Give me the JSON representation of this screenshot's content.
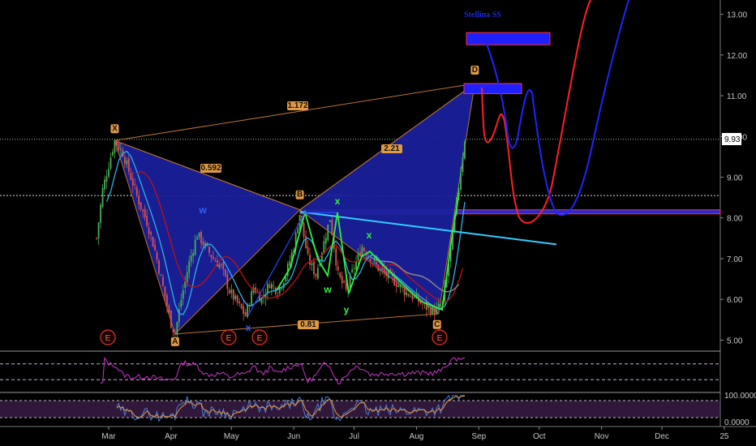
{
  "colors": {
    "background": "#000000",
    "pattern_fill": "#1a1f9e",
    "pattern_edge": "#b87333",
    "candle_up": "#4caf50",
    "candle_down": "#d9534f",
    "price_tag": "#ffffff",
    "trend_line": "#33ccff",
    "projection_red": "#ff2020",
    "projection_blue": "#2222ff",
    "rsi": "#cc33cc",
    "stoch_fast": "#4a7fd9",
    "stoch_slow": "#e39b3c",
    "zone_box": "#2020ff",
    "zone_border": "#ff3030"
  },
  "annotation_text": "Stellina SS",
  "price_tag": "9.93",
  "chart_data": {
    "type": "candlestick",
    "title": "",
    "xlabel": "",
    "ylabel": "",
    "x_ticks": [
      "Mar",
      "Apr",
      "May",
      "Jun",
      "Jul",
      "Aug",
      "Sep",
      "Oct",
      "Nov",
      "Dec",
      "25"
    ],
    "y_ticks": [
      "13.00",
      "12.00",
      "11.00",
      "10.00",
      "9.00",
      "8.00",
      "7.00",
      "6.00",
      "5.00"
    ],
    "ylim": [
      4.75,
      13.35
    ],
    "xlim_days": [
      0,
      310
    ],
    "tick_days": [
      0,
      31,
      61,
      92,
      122,
      153,
      184,
      214,
      245,
      275,
      306
    ],
    "price_path": [
      [
        "Feb 24",
        7.5
      ],
      [
        "Feb 27",
        8.7
      ],
      [
        "Mar 1",
        9.3
      ],
      [
        "Mar 4",
        9.9
      ],
      [
        "Mar 8",
        9.6
      ],
      [
        "Mar 12",
        9.0
      ],
      [
        "Mar 16",
        8.4
      ],
      [
        "Mar 20",
        7.9
      ],
      [
        "Mar 24",
        7.2
      ],
      [
        "Mar 28",
        6.3
      ],
      [
        "Apr 1",
        5.4
      ],
      [
        "Apr 3",
        5.15
      ],
      [
        "Apr 6",
        6.0
      ],
      [
        "Apr 10",
        6.9
      ],
      [
        "Apr 14",
        7.6
      ],
      [
        "Apr 18",
        7.3
      ],
      [
        "Apr 22",
        7.0
      ],
      [
        "Apr 26",
        6.8
      ],
      [
        "Apr 30",
        6.2
      ],
      [
        "May 4",
        5.9
      ],
      [
        "May 8",
        5.6
      ],
      [
        "May 12",
        6.3
      ],
      [
        "May 16",
        6.0
      ],
      [
        "May 20",
        6.4
      ],
      [
        "May 24",
        6.2
      ],
      [
        "May 28",
        6.6
      ],
      [
        "Jun 1",
        7.3
      ],
      [
        "Jun 4",
        8.1
      ],
      [
        "Jun 8",
        7.0
      ],
      [
        "Jun 12",
        6.6
      ],
      [
        "Jun 16",
        7.4
      ],
      [
        "Jun 19",
        8.0
      ],
      [
        "Jun 23",
        6.6
      ],
      [
        "Jun 27",
        6.2
      ],
      [
        "Jul 1",
        6.8
      ],
      [
        "Jul 5",
        7.3
      ],
      [
        "Jul 9",
        7.0
      ],
      [
        "Jul 14",
        6.7
      ],
      [
        "Jul 20",
        6.5
      ],
      [
        "Jul 26",
        6.2
      ],
      [
        "Aug 1",
        6.0
      ],
      [
        "Aug 6",
        5.8
      ],
      [
        "Aug 10",
        5.7
      ],
      [
        "Aug 14",
        5.9
      ],
      [
        "Aug 18",
        7.2
      ],
      [
        "Aug 20",
        8.0
      ],
      [
        "Aug 22",
        8.8
      ],
      [
        "Aug 25",
        9.93
      ]
    ],
    "pattern_points": [
      {
        "label": "X",
        "date": "Mar 4",
        "price": 9.9
      },
      {
        "label": "A",
        "date": "Apr 3",
        "price": 5.15
      },
      {
        "label": "B",
        "date": "Jun 4",
        "price": 8.2
      },
      {
        "label": "C",
        "date": "Aug 12",
        "price": 5.65
      },
      {
        "label": "D",
        "date": "Aug 30",
        "price": 11.3
      }
    ],
    "ratios": [
      "0.592",
      "1.172",
      "2.21",
      "0.81"
    ],
    "wave_labels": [
      "w",
      "w",
      "x",
      "x",
      "y",
      "x"
    ],
    "event_markers": [
      "E",
      "E",
      "E",
      "E"
    ],
    "hlines": [
      9.93,
      8.55,
      8.2,
      8.1
    ],
    "zones": [
      {
        "y_top": 12.55,
        "y_bottom": 12.25
      },
      {
        "y_top": 11.3,
        "y_bottom": 11.05
      }
    ],
    "indicators": {
      "rsi_levels": [
        70,
        30
      ],
      "stoch_axis": [
        "100.0000",
        "0.0000"
      ]
    }
  }
}
